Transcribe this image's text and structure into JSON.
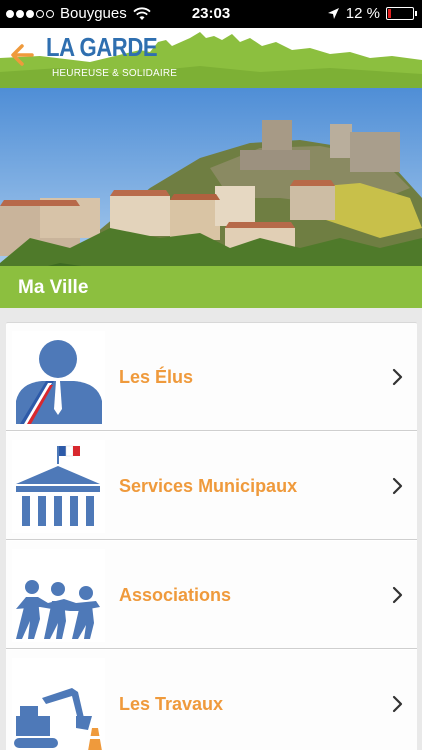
{
  "status_bar": {
    "carrier": "Bouygues",
    "time": "23:03",
    "battery": "12 %",
    "battery_level": 0.12,
    "signal_bars": 3
  },
  "header": {
    "logo_title": "LA GARDE",
    "logo_subtitle": "HEUREUSE & SOLIDAIRE",
    "back_icon": "arrow-left-icon",
    "accent_color": "#ef9a3c",
    "green_color": "#8cbf3f",
    "blue_color": "#2f6fb0"
  },
  "hero": {
    "title": "Ma Ville"
  },
  "menu": {
    "items": [
      {
        "label": "Les Élus",
        "icon": "elected-official-icon"
      },
      {
        "label": "Services Municipaux",
        "icon": "town-hall-icon"
      },
      {
        "label": "Associations",
        "icon": "people-group-icon"
      },
      {
        "label": "Les Travaux",
        "icon": "excavator-icon"
      }
    ]
  }
}
